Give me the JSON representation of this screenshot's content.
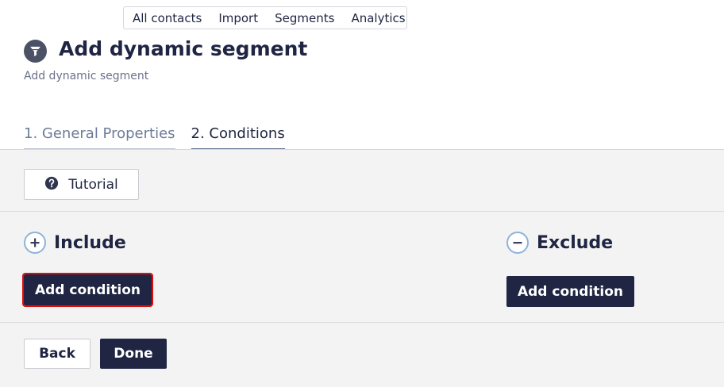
{
  "topnav": {
    "items": [
      {
        "label": "All contacts"
      },
      {
        "label": "Import"
      },
      {
        "label": "Segments"
      },
      {
        "label": "Analytics"
      }
    ]
  },
  "header": {
    "icon": "filter-icon",
    "title": "Add dynamic segment",
    "subtitle": "Add dynamic segment"
  },
  "tabs": [
    {
      "label": "1. General Properties",
      "active": false
    },
    {
      "label": "2. Conditions",
      "active": true
    }
  ],
  "tutorial": {
    "label": "Tutorial",
    "icon": "question-circle-icon"
  },
  "include": {
    "title": "Include",
    "icon": "plus-circle-icon",
    "button_label": "Add condition"
  },
  "exclude": {
    "title": "Exclude",
    "icon": "minus-circle-icon",
    "button_label": "Add condition"
  },
  "footer": {
    "back_label": "Back",
    "done_label": "Done"
  },
  "colors": {
    "primary": "#1f2542",
    "highlight": "#e00d0d",
    "content_bg": "#f3f3f3",
    "icon_ring": "#8fb3d9"
  }
}
